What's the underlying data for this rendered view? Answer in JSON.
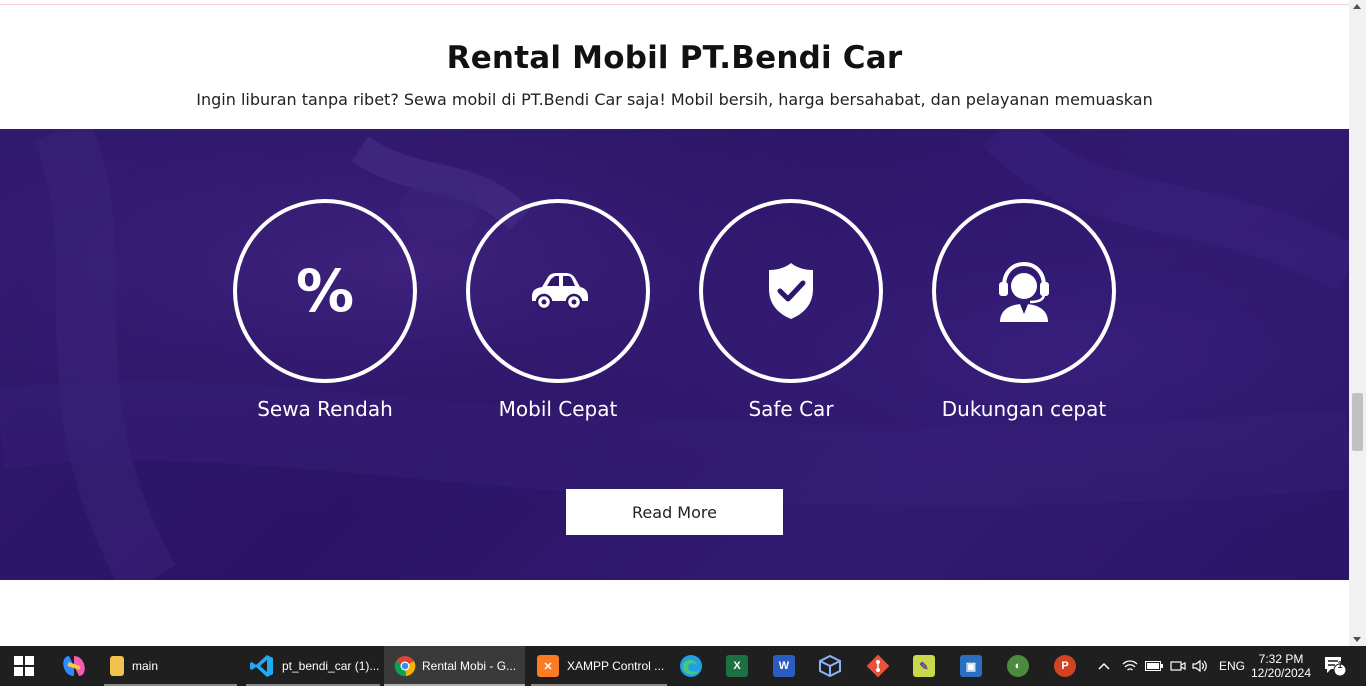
{
  "page": {
    "title": "Rental Mobil PT.Bendi Car",
    "subtitle": "Ingin liburan tanpa ribet? Sewa mobil di PT.Bendi Car saja! Mobil bersih, harga bersahabat, dan pelayanan memuaskan"
  },
  "features": [
    {
      "label": "Sewa Rendah",
      "icon": "percent-icon",
      "glyph": "%"
    },
    {
      "label": "Mobil Cepat",
      "icon": "car-icon"
    },
    {
      "label": "Safe Car",
      "icon": "shield-check-icon"
    },
    {
      "label": "Dukungan cepat",
      "icon": "headset-support-icon"
    }
  ],
  "cta": {
    "label": "Read More"
  },
  "colors": {
    "band": "#2e176b",
    "ring": "#ffffff",
    "button_bg": "#ffffff",
    "taskbar": "#1f1f1f"
  },
  "taskbar": {
    "items": [
      {
        "label": "",
        "icon": "windows-start-icon"
      },
      {
        "label": "",
        "icon": "copilot-icon"
      },
      {
        "label": "main",
        "icon": "file-explorer-icon"
      },
      {
        "label": "pt_bendi_car (1)...",
        "icon": "vscode-icon"
      },
      {
        "label": "Rental Mobi - G...",
        "icon": "chrome-icon"
      },
      {
        "label": "XAMPP Control ...",
        "icon": "xampp-icon"
      },
      {
        "label": "",
        "icon": "edge-icon"
      },
      {
        "label": "",
        "icon": "excel-icon"
      },
      {
        "label": "",
        "icon": "word-icon"
      },
      {
        "label": "",
        "icon": "virtualbox-icon"
      },
      {
        "label": "",
        "icon": "git-icon"
      },
      {
        "label": "",
        "icon": "notepad-icon"
      },
      {
        "label": "",
        "icon": "network-tool-icon"
      },
      {
        "label": "",
        "icon": "app-icon"
      },
      {
        "label": "",
        "icon": "powerpoint-icon"
      }
    ],
    "tray": {
      "language": "ENG",
      "time": "7:32 PM",
      "date": "12/20/2024",
      "notifications": "1"
    }
  }
}
